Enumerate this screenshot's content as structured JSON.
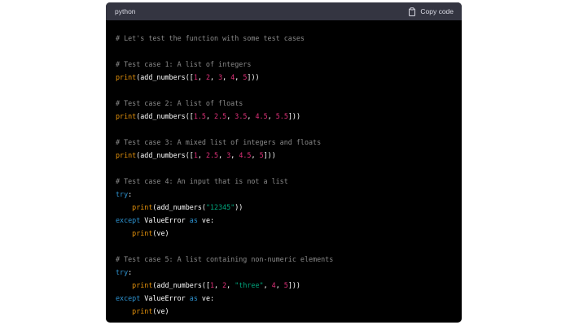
{
  "header": {
    "language": "python",
    "copy_label": "Copy code",
    "copy_icon": "clipboard-icon"
  },
  "colors": {
    "background": "#000000",
    "header_background": "#343541",
    "comment": "#8b8b8b",
    "builtin": "#e9950c",
    "number": "#df3079",
    "keyword": "#2e95d3",
    "string": "#00a67d"
  },
  "code": {
    "lines": [
      [
        {
          "t": "comment",
          "v": "# Let's test the function with some test cases"
        }
      ],
      [],
      [
        {
          "t": "comment",
          "v": "# Test case 1: A list of integers"
        }
      ],
      [
        {
          "t": "builtin",
          "v": "print"
        },
        {
          "t": "plain",
          "v": "(add_numbers(["
        },
        {
          "t": "number",
          "v": "1"
        },
        {
          "t": "plain",
          "v": ", "
        },
        {
          "t": "number",
          "v": "2"
        },
        {
          "t": "plain",
          "v": ", "
        },
        {
          "t": "number",
          "v": "3"
        },
        {
          "t": "plain",
          "v": ", "
        },
        {
          "t": "number",
          "v": "4"
        },
        {
          "t": "plain",
          "v": ", "
        },
        {
          "t": "number",
          "v": "5"
        },
        {
          "t": "plain",
          "v": "]))"
        }
      ],
      [],
      [
        {
          "t": "comment",
          "v": "# Test case 2: A list of floats"
        }
      ],
      [
        {
          "t": "builtin",
          "v": "print"
        },
        {
          "t": "plain",
          "v": "(add_numbers(["
        },
        {
          "t": "number",
          "v": "1.5"
        },
        {
          "t": "plain",
          "v": ", "
        },
        {
          "t": "number",
          "v": "2.5"
        },
        {
          "t": "plain",
          "v": ", "
        },
        {
          "t": "number",
          "v": "3.5"
        },
        {
          "t": "plain",
          "v": ", "
        },
        {
          "t": "number",
          "v": "4.5"
        },
        {
          "t": "plain",
          "v": ", "
        },
        {
          "t": "number",
          "v": "5.5"
        },
        {
          "t": "plain",
          "v": "]))"
        }
      ],
      [],
      [
        {
          "t": "comment",
          "v": "# Test case 3: A mixed list of integers and floats"
        }
      ],
      [
        {
          "t": "builtin",
          "v": "print"
        },
        {
          "t": "plain",
          "v": "(add_numbers(["
        },
        {
          "t": "number",
          "v": "1"
        },
        {
          "t": "plain",
          "v": ", "
        },
        {
          "t": "number",
          "v": "2.5"
        },
        {
          "t": "plain",
          "v": ", "
        },
        {
          "t": "number",
          "v": "3"
        },
        {
          "t": "plain",
          "v": ", "
        },
        {
          "t": "number",
          "v": "4.5"
        },
        {
          "t": "plain",
          "v": ", "
        },
        {
          "t": "number",
          "v": "5"
        },
        {
          "t": "plain",
          "v": "]))"
        }
      ],
      [],
      [
        {
          "t": "comment",
          "v": "# Test case 4: An input that is not a list"
        }
      ],
      [
        {
          "t": "keyword",
          "v": "try"
        },
        {
          "t": "plain",
          "v": ":"
        }
      ],
      [
        {
          "t": "plain",
          "v": "    "
        },
        {
          "t": "builtin",
          "v": "print"
        },
        {
          "t": "plain",
          "v": "(add_numbers("
        },
        {
          "t": "string",
          "v": "\"12345\""
        },
        {
          "t": "plain",
          "v": "))"
        }
      ],
      [
        {
          "t": "keyword",
          "v": "except"
        },
        {
          "t": "plain",
          "v": " ValueError "
        },
        {
          "t": "keyword",
          "v": "as"
        },
        {
          "t": "plain",
          "v": " ve:"
        }
      ],
      [
        {
          "t": "plain",
          "v": "    "
        },
        {
          "t": "builtin",
          "v": "print"
        },
        {
          "t": "plain",
          "v": "(ve)"
        }
      ],
      [],
      [
        {
          "t": "comment",
          "v": "# Test case 5: A list containing non-numeric elements"
        }
      ],
      [
        {
          "t": "keyword",
          "v": "try"
        },
        {
          "t": "plain",
          "v": ":"
        }
      ],
      [
        {
          "t": "plain",
          "v": "    "
        },
        {
          "t": "builtin",
          "v": "print"
        },
        {
          "t": "plain",
          "v": "(add_numbers(["
        },
        {
          "t": "number",
          "v": "1"
        },
        {
          "t": "plain",
          "v": ", "
        },
        {
          "t": "number",
          "v": "2"
        },
        {
          "t": "plain",
          "v": ", "
        },
        {
          "t": "string",
          "v": "\"three\""
        },
        {
          "t": "plain",
          "v": ", "
        },
        {
          "t": "number",
          "v": "4"
        },
        {
          "t": "plain",
          "v": ", "
        },
        {
          "t": "number",
          "v": "5"
        },
        {
          "t": "plain",
          "v": "]))"
        }
      ],
      [
        {
          "t": "keyword",
          "v": "except"
        },
        {
          "t": "plain",
          "v": " ValueError "
        },
        {
          "t": "keyword",
          "v": "as"
        },
        {
          "t": "plain",
          "v": " ve:"
        }
      ],
      [
        {
          "t": "plain",
          "v": "    "
        },
        {
          "t": "builtin",
          "v": "print"
        },
        {
          "t": "plain",
          "v": "(ve)"
        }
      ]
    ]
  }
}
